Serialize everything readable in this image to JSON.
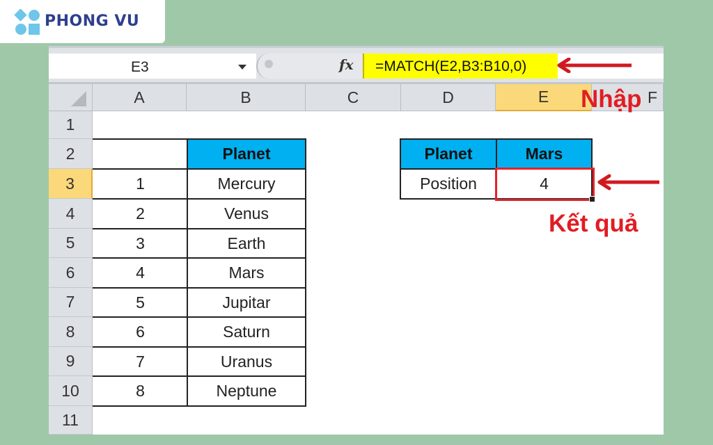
{
  "brand": {
    "name": "PHONG VU",
    "logo_color": "#6ec6ea",
    "text_color": "#2e3f8f"
  },
  "formula_bar": {
    "name_box": "E3",
    "fx_label": "fx",
    "formula": "=MATCH(E2,B3:B10,0)",
    "highlight_color": "#ffff00"
  },
  "columns": [
    "A",
    "B",
    "C",
    "D",
    "E",
    "F"
  ],
  "selected_column": "E",
  "rows": [
    "1",
    "2",
    "3",
    "4",
    "5",
    "6",
    "7",
    "8",
    "9",
    "10",
    "11"
  ],
  "selected_row": "3",
  "planet_table": {
    "header": "Planet",
    "header_color": "#00b0f0",
    "items": [
      {
        "index": "1",
        "planet": "Mercury"
      },
      {
        "index": "2",
        "planet": "Venus"
      },
      {
        "index": "3",
        "planet": "Earth"
      },
      {
        "index": "4",
        "planet": "Mars"
      },
      {
        "index": "5",
        "planet": "Jupitar"
      },
      {
        "index": "6",
        "planet": "Saturn"
      },
      {
        "index": "7",
        "planet": "Uranus"
      },
      {
        "index": "8",
        "planet": "Neptune"
      }
    ]
  },
  "lookup_table": {
    "label_header": "Planet",
    "value_header": "Mars",
    "label_row": "Position",
    "result": "4"
  },
  "annotations": {
    "input_label": "Nhập",
    "result_label": "Kết quả",
    "color": "#e11d22"
  }
}
